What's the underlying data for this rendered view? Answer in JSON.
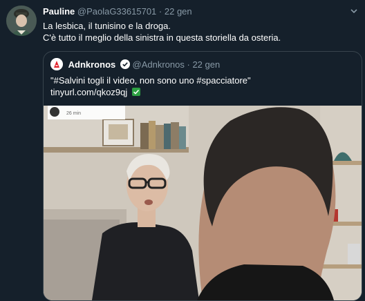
{
  "tweet": {
    "author_name": "Pauline",
    "author_handle": "@PaolaG33615701",
    "separator": "·",
    "date": "22 gen",
    "lines": [
      "La lesbica, il tunisino e la droga.",
      "C'è tutto il meglio della sinistra in questa storiella da osteria."
    ]
  },
  "quoted": {
    "author_name": "Adnkronos",
    "author_handle": "@Adnkronos",
    "separator": "·",
    "date": "22 gen",
    "line1": "\"#Salvini togli il video, non sono uno #spacciatore\"",
    "link": "tinyurl.com/qkoz9qj",
    "video_overlay_time": "26 min"
  },
  "icons": {
    "chevron": "chevron-down-icon",
    "verified": "verified-badge-icon",
    "check": "check-mark-icon"
  },
  "colors": {
    "background": "#15202b",
    "muted_text": "#8899a6",
    "verified": "#ffffff",
    "check": "#2ea043"
  }
}
